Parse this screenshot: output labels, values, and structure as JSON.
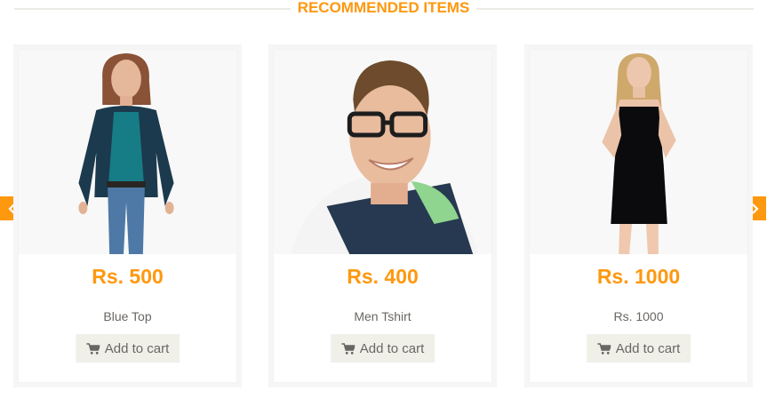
{
  "section": {
    "title": "RECOMMENDED ITEMS"
  },
  "products": [
    {
      "price": "Rs. 500",
      "name": "Blue Top",
      "cta": "Add to cart"
    },
    {
      "price": "Rs. 400",
      "name": "Men Tshirt",
      "cta": "Add to cart"
    },
    {
      "price": "Rs. 1000",
      "name": "Rs. 1000",
      "cta": "Add to cart"
    }
  ],
  "carousel": {
    "prev_icon": "chevron-left-icon",
    "next_icon": "chevron-right-icon"
  },
  "icons": {
    "cart": "shopping-cart-icon"
  },
  "colors": {
    "accent": "#FE980F",
    "text": "#696763",
    "button_bg": "#F0F0E9",
    "card_border": "#F7F5F5"
  }
}
